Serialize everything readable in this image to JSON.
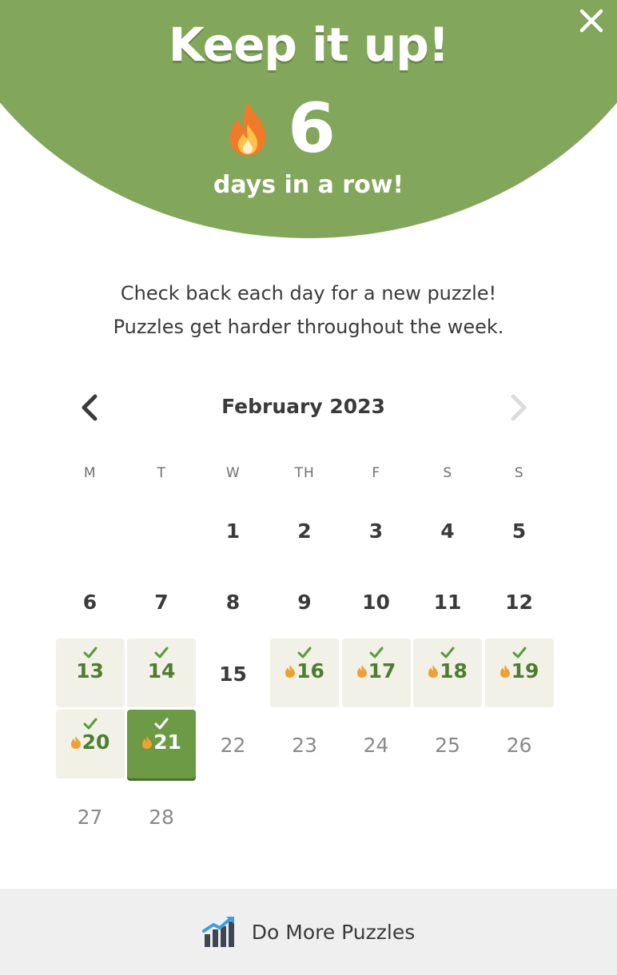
{
  "hero": {
    "title": "Keep it up!",
    "streak_count": "6",
    "streak_label": "days in a row!",
    "close_icon": "close-icon",
    "flame_icon": "flame-icon",
    "background_color": "#82a65a"
  },
  "message": {
    "line1": "Check back each day for a new puzzle!",
    "line2": "Puzzles get harder throughout the week."
  },
  "calendar": {
    "month_label": "February 2023",
    "prev_icon": "chevron-left-icon",
    "next_icon": "chevron-right-icon",
    "next_enabled": false,
    "weekdays": [
      "M",
      "T",
      "W",
      "TH",
      "F",
      "S",
      "S"
    ],
    "days": [
      {
        "day": null
      },
      {
        "day": null
      },
      {
        "day": "1",
        "state": "past"
      },
      {
        "day": "2",
        "state": "past"
      },
      {
        "day": "3",
        "state": "past"
      },
      {
        "day": "4",
        "state": "past"
      },
      {
        "day": "5",
        "state": "past"
      },
      {
        "day": "6",
        "state": "past"
      },
      {
        "day": "7",
        "state": "past"
      },
      {
        "day": "8",
        "state": "past"
      },
      {
        "day": "9",
        "state": "past"
      },
      {
        "day": "10",
        "state": "past"
      },
      {
        "day": "11",
        "state": "past"
      },
      {
        "day": "12",
        "state": "past"
      },
      {
        "day": "13",
        "state": "solved",
        "flame": false
      },
      {
        "day": "14",
        "state": "solved",
        "flame": false
      },
      {
        "day": "15",
        "state": "past"
      },
      {
        "day": "16",
        "state": "solved",
        "flame": true
      },
      {
        "day": "17",
        "state": "solved",
        "flame": true
      },
      {
        "day": "18",
        "state": "solved",
        "flame": true
      },
      {
        "day": "19",
        "state": "solved",
        "flame": true
      },
      {
        "day": "20",
        "state": "solved",
        "flame": true
      },
      {
        "day": "21",
        "state": "today",
        "flame": true
      },
      {
        "day": "22",
        "state": "future"
      },
      {
        "day": "23",
        "state": "future"
      },
      {
        "day": "24",
        "state": "future"
      },
      {
        "day": "25",
        "state": "future"
      },
      {
        "day": "26",
        "state": "future"
      },
      {
        "day": "27",
        "state": "future"
      },
      {
        "day": "28",
        "state": "future"
      }
    ],
    "colors": {
      "solved_bg": "#f1f1e8",
      "solved_text": "#4e7d2f",
      "today_bg": "#6d9a44",
      "flame": "#f0a030"
    }
  },
  "footer": {
    "label": "Do More Puzzles",
    "icon": "bar-chart-icon"
  }
}
